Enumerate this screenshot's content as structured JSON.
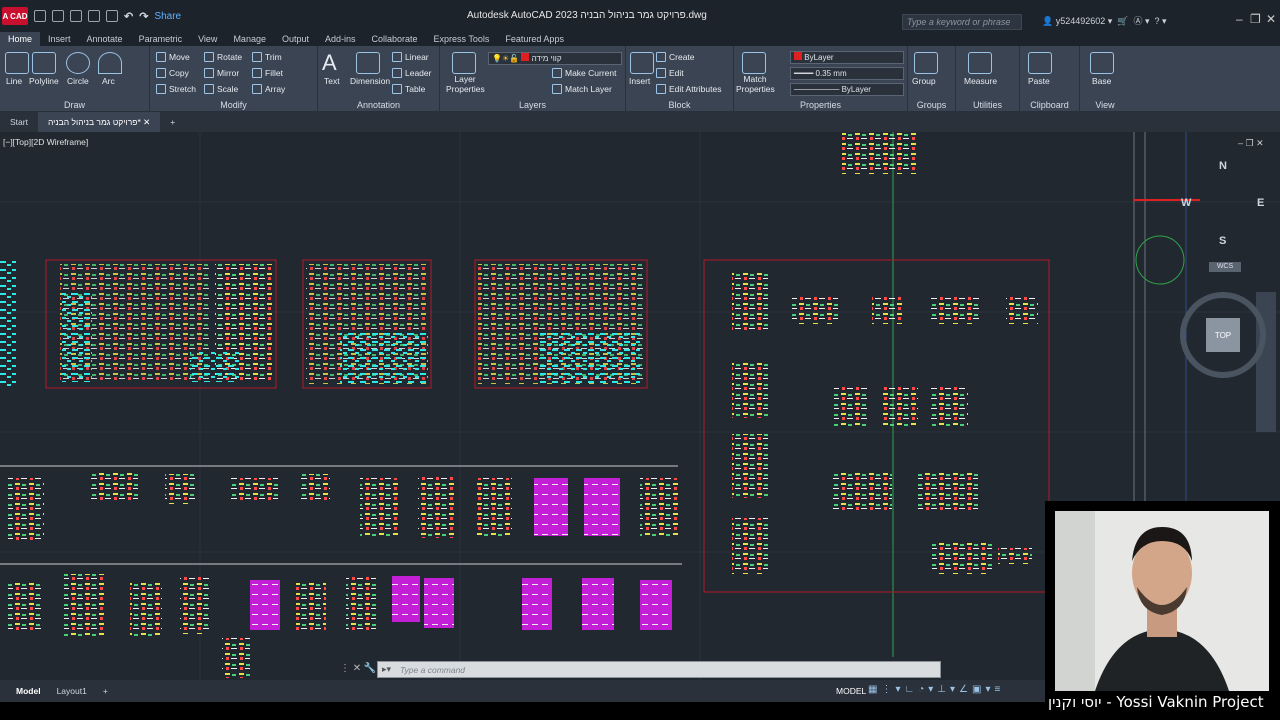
{
  "app": {
    "logo": "A CAD",
    "share": "Share",
    "title": "Autodesk AutoCAD 2023  פרויקט גמר בניהול הבניה.dwg",
    "search_placeholder": "Type a keyword or phrase",
    "user": "y524492602"
  },
  "menu": [
    "Home",
    "Insert",
    "Annotate",
    "Parametric",
    "View",
    "Manage",
    "Output",
    "Add-ins",
    "Collaborate",
    "Express Tools",
    "Featured Apps"
  ],
  "ribbon": {
    "draw": {
      "title": "Draw",
      "line": "Line",
      "polyline": "Polyline",
      "circle": "Circle",
      "arc": "Arc"
    },
    "modify": {
      "title": "Modify",
      "move": "Move",
      "rotate": "Rotate",
      "trim": "Trim",
      "copy": "Copy",
      "mirror": "Mirror",
      "fillet": "Fillet",
      "stretch": "Stretch",
      "scale": "Scale",
      "array": "Array"
    },
    "annotation": {
      "title": "Annotation",
      "text": "Text",
      "dimension": "Dimension",
      "linear": "Linear",
      "leader": "Leader",
      "table": "Table"
    },
    "layers": {
      "title": "Layers",
      "layer_properties": "Layer Properties",
      "current_layer": "קווי מידה",
      "make_current": "Make Current",
      "match_layer": "Match Layer"
    },
    "block": {
      "title": "Block",
      "insert": "Insert",
      "create": "Create",
      "edit": "Edit",
      "edit_attributes": "Edit Attributes"
    },
    "properties": {
      "title": "Properties",
      "match_properties": "Match Properties",
      "color": "ByLayer",
      "lineweight": "0.35 mm",
      "linetype": "ByLayer"
    },
    "groups": {
      "title": "Groups",
      "group": "Group"
    },
    "utilities": {
      "title": "Utilities",
      "measure": "Measure"
    },
    "clipboard": {
      "title": "Clipboard",
      "paste": "Paste"
    },
    "view": {
      "title": "View",
      "base": "Base"
    }
  },
  "file_tabs": {
    "start": "Start",
    "current": "פרויקט גמר בניהול הבניה*"
  },
  "viewport": {
    "label": "[−][Top][2D Wireframe]"
  },
  "viewcube": {
    "n": "N",
    "s": "S",
    "e": "E",
    "w": "W",
    "top": "TOP",
    "wcs": "WCS"
  },
  "command": {
    "placeholder": "Type a command"
  },
  "status": {
    "model_tab": "Model",
    "layout_tab": "Layout1",
    "model_label": "MODEL"
  },
  "webcam": {
    "caption": "יוסי וקנין - Yossi Vaknin Project"
  },
  "colors": {
    "accent": "#c8102e",
    "ribbon": "#3b4453",
    "canvas": "#212830",
    "sheet_border": "#b51a2a"
  }
}
